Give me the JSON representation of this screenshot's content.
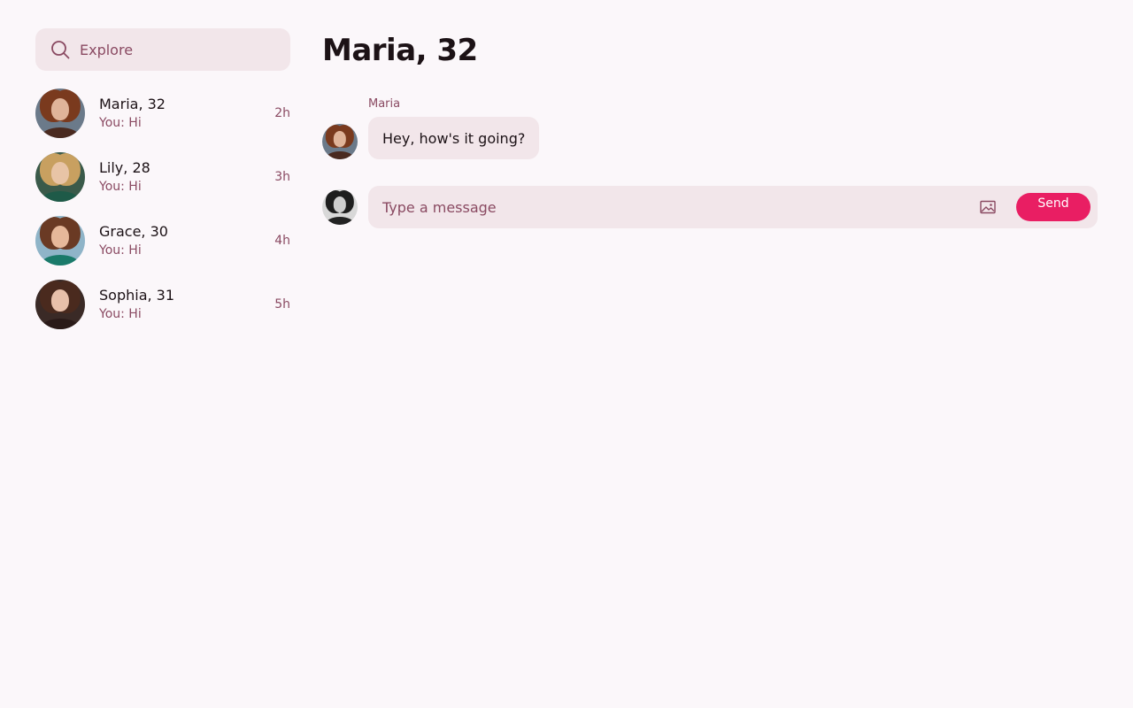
{
  "search": {
    "placeholder": "Explore"
  },
  "conversations": [
    {
      "name": "Maria, 32",
      "preview": "You: Hi",
      "time": "2h"
    },
    {
      "name": "Lily, 28",
      "preview": "You: Hi",
      "time": "3h"
    },
    {
      "name": "Grace, 30",
      "preview": "You: Hi",
      "time": "4h"
    },
    {
      "name": "Sophia, 31",
      "preview": "You: Hi",
      "time": "5h"
    }
  ],
  "chat": {
    "title": "Maria, 32",
    "messages": [
      {
        "sender": "Maria",
        "text": "Hey, how's it going?"
      }
    ]
  },
  "composer": {
    "placeholder": "Type a message",
    "send_label": "Send",
    "image_icon": "image-icon"
  },
  "colors": {
    "background": "#fbf7fa",
    "surface": "#f2e6ea",
    "accent": "#e91e63",
    "muted_text": "#8a4a62",
    "text": "#1c1216"
  }
}
